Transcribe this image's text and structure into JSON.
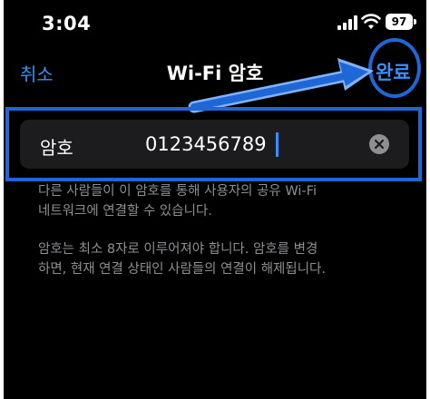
{
  "status_bar": {
    "time": "3:04",
    "battery_level": "97",
    "signal_icon": "signal-bars-icon",
    "wifi_icon": "wifi-icon"
  },
  "nav": {
    "cancel_label": "취소",
    "title": "Wi-Fi 암호",
    "done_label": "완료"
  },
  "password_field": {
    "label": "암호",
    "value": "0123456789",
    "clear_icon": "clear-icon"
  },
  "footnotes": {
    "sharing_line1": "다른 사람들이 이 암호를 통해 사용자의 공유 Wi-Fi",
    "sharing_line2": "네트워크에 연결할 수 있습니다.",
    "rules_line1": "암호는 최소 8자로 이루어져야 합니다. 암호를 변경",
    "rules_line2": "하면, 현재 연결 상태인 사람들의 연결이 해제됩니다."
  },
  "colors": {
    "accent": "#3a8ef6",
    "annotation": "#1f66d6",
    "background": "#000000",
    "field_background": "#1c1c1e",
    "secondary_text": "#8e8e93"
  }
}
